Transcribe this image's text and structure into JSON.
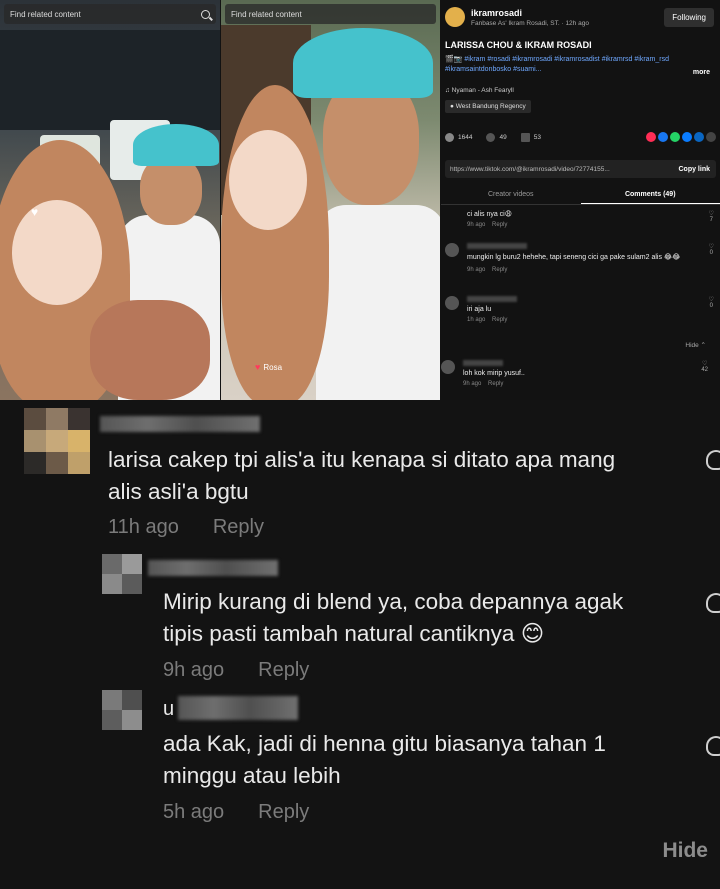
{
  "video_left": {
    "search_text": "Find related content"
  },
  "video_mid": {
    "search_text": "Find related content",
    "tag_label": "Rosa"
  },
  "post": {
    "author": "ikramrosadi",
    "author_sub": "Fanbase As' Ikram Rosadi, ST. · 12h ago",
    "follow_label": "Following",
    "title": "LARISSA CHOU & IKRAM ROSADI",
    "caption": "🎬📷 #ikram #rosadi #ikramrosadi #ikramrosadist #ikramrsd #ikram_rsd #ikramsaintdonbosko #suami...",
    "more_label": "more",
    "music": "♫ Nyaman - Ash Fearyll",
    "location": "West Bandung Regency",
    "likes": "1644",
    "comments_count": "49",
    "saves": "53",
    "link_url": "https://www.tiktok.com/@ikramrosadi/video/72774155...",
    "copy_label": "Copy link",
    "tab_creator": "Creator videos",
    "tab_comments": "Comments (49)",
    "hide_small": "Hide ⌃",
    "mini_comments": [
      {
        "text": "ci alis nya ci😩",
        "time": "9h ago",
        "reply": "Reply",
        "likes": "7"
      },
      {
        "text": "mungkin lg buru2 hehehe, tapi seneng cici ga pake sulam2 alis 😂😂",
        "time": "9h ago",
        "reply": "Reply",
        "likes": "0"
      },
      {
        "text": "iri aja lu",
        "time": "1h ago",
        "reply": "Reply",
        "likes": "0"
      },
      {
        "text": "loh kok mirip yusuf..",
        "time": "9h ago",
        "reply": "Reply",
        "likes": "42"
      }
    ]
  },
  "comments": [
    {
      "line1": "larisa cakep tpi alis'a itu kenapa si ditato apa mang",
      "line2": "alis asli'a bgtu",
      "time": "11h ago",
      "reply": "Reply"
    },
    {
      "line1": "Mirip kurang di blend ya, coba depannya agak",
      "line2": "tipis pasti tambah natural cantiknya 😊",
      "time": "9h ago",
      "reply": "Reply"
    },
    {
      "name_visible": "u",
      "line1": "ada Kak, jadi di henna gitu biasanya tahan 1",
      "line2": "minggu atau lebih",
      "time": "5h ago",
      "reply": "Reply"
    }
  ],
  "hide_label": "Hide",
  "colors": {
    "accent_blue": "#6fa8ff",
    "cap_teal": "#45c2cc",
    "hijab_brown": "#c1865f",
    "like_red": "#ff3b5c"
  }
}
